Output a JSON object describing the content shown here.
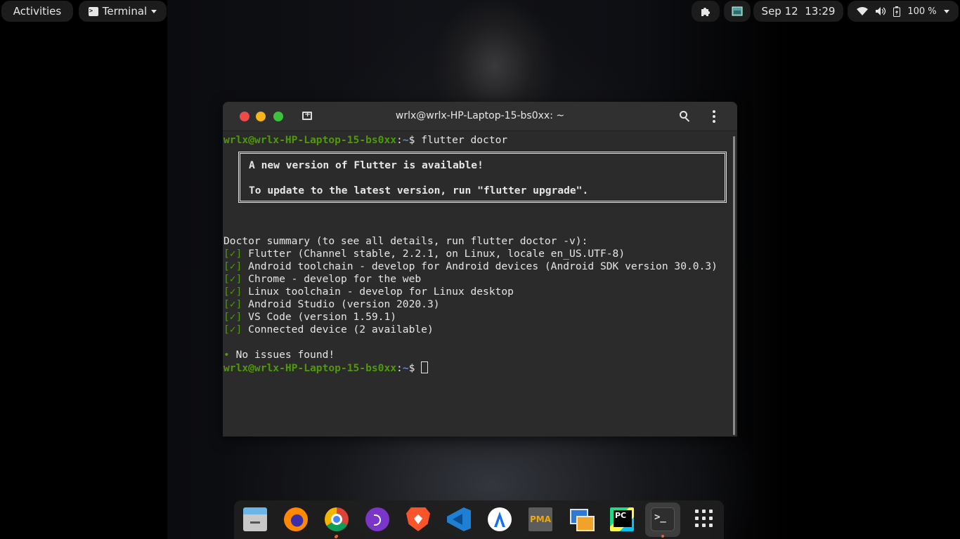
{
  "topbar": {
    "activities": "Activities",
    "app_menu": "Terminal",
    "clock": "Sep 12  13:29",
    "battery": "100 %"
  },
  "window": {
    "title": "wrlx@wrlx-HP-Laptop-15-bs0xx: ~"
  },
  "terminal": {
    "prompt_user": "wrlx@wrlx-HP-Laptop-15-bs0xx",
    "prompt_sep": ":",
    "prompt_path": "~",
    "prompt_symbol": "$ ",
    "command": "flutter doctor",
    "notice_line1": "A new version of Flutter is available!",
    "notice_line2": "To update to the latest version, run \"flutter upgrade\".",
    "summary": "Doctor summary (to see all details, run flutter doctor -v):",
    "checks": [
      "Flutter (Channel stable, 2.2.1, on Linux, locale en_US.UTF-8)",
      "Android toolchain - develop for Android devices (Android SDK version 30.0.3)",
      "Chrome - develop for the web",
      "Linux toolchain - develop for Linux desktop",
      "Android Studio (version 2020.3)",
      "VS Code (version 1.59.1)",
      "Connected device (2 available)"
    ],
    "check_mark": "[✓]",
    "bullet": "•",
    "result": "No issues found!"
  },
  "dock": {
    "items": [
      "files-icon",
      "firefox-icon",
      "chrome-icon",
      "podcasts-icon",
      "brave-icon",
      "vscode-icon",
      "android-studio-icon",
      "phpmyadmin-icon",
      "remote-desktop-icon",
      "pycharm-icon",
      "terminal-icon",
      "app-grid-icon"
    ],
    "pma_label": "PMA",
    "terminal_glyph": ">_"
  },
  "colors": {
    "prompt_user": "#4e9a06",
    "prompt_path": "#5a8fd6",
    "text": "#e6e6e6",
    "terminal_bg": "#2b2b2b"
  }
}
